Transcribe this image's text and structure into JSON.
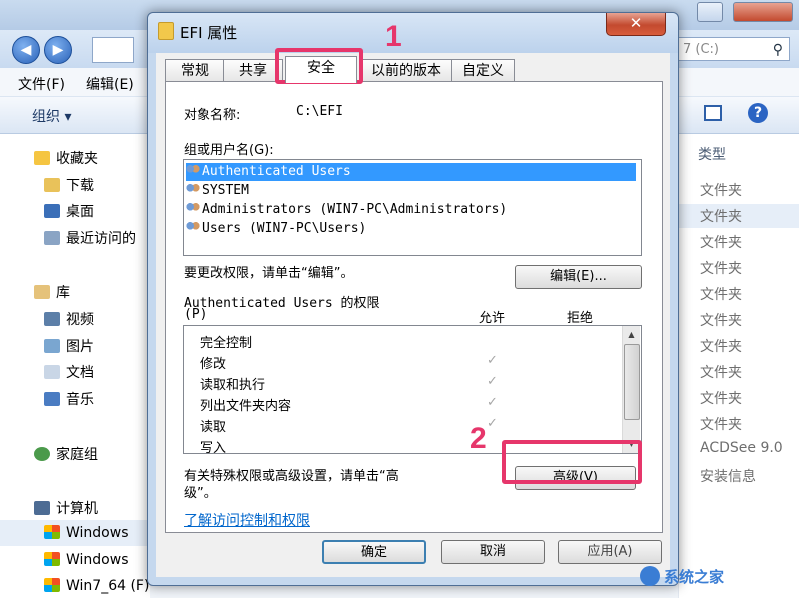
{
  "explorer": {
    "search_text": "7 (C:)",
    "menu": [
      "文件(F)",
      "编辑(E)"
    ],
    "toolbar_org": "组织 ▾",
    "sidebar": [
      "收藏夹",
      "下载",
      "桌面",
      "最近访问的",
      "库",
      "视频",
      "图片",
      "文档",
      "音乐",
      "家庭组",
      "计算机",
      "Windows",
      "Windows",
      "Win7_64 (F)"
    ],
    "column_header": "类型",
    "types": [
      "文件夹",
      "文件夹",
      "文件夹",
      "文件夹",
      "文件夹",
      "文件夹",
      "文件夹",
      "文件夹",
      "文件夹",
      "文件夹",
      "ACDSee 9.0",
      "安装信息"
    ]
  },
  "dialog": {
    "title": "EFI 属性",
    "tabs": [
      "常规",
      "共享",
      "安全",
      "以前的版本",
      "自定义"
    ],
    "object_label": "对象名称:",
    "object_value": "C:\\EFI",
    "groups_label": "组或用户名(G):",
    "users": [
      "Authenticated Users",
      "SYSTEM",
      "Administrators (WIN7-PC\\Administrators)",
      "Users (WIN7-PC\\Users)"
    ],
    "change_hint": "要更改权限，请单击“编辑”。",
    "edit_button": "编辑(E)...",
    "perm_title_line1": "Authenticated Users 的权限",
    "perm_title_line2": "(P)",
    "allow_header": "允许",
    "deny_header": "拒绝",
    "permissions": [
      "完全控制",
      "修改",
      "读取和执行",
      "列出文件夹内容",
      "读取",
      "写入"
    ],
    "advanced_hint_line1": "有关特殊权限或高级设置，请单击“高",
    "advanced_hint_line2": "级”。",
    "advanced_button": "高级(V)",
    "learn_link": "了解访问控制和权限",
    "ok_button": "确定",
    "cancel_button": "取消",
    "apply_button": "应用(A)"
  },
  "annotations": {
    "step1": "1",
    "step2": "2"
  },
  "watermark": "系统之家",
  "colors": {
    "highlight": "#e6366b",
    "selection": "#3399ff",
    "link": "#0066cc"
  }
}
